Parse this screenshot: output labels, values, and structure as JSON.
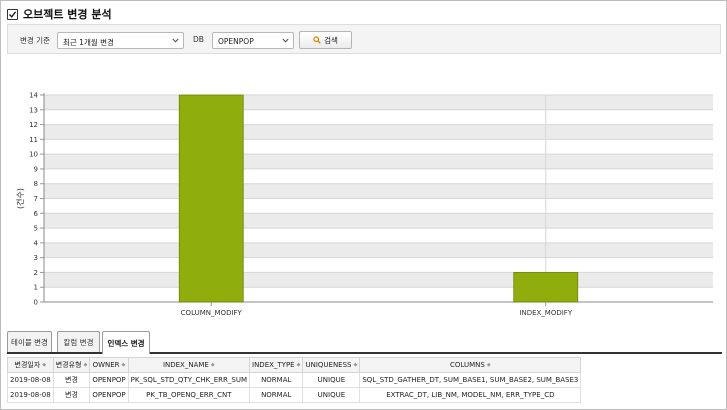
{
  "title": "오브젝트 변경 분석",
  "filters": {
    "criteria_label": "변경 기준",
    "criteria_value": "최근 1개월 변경",
    "db_label": "DB",
    "db_value": "OPENPOP",
    "search_label": "검색"
  },
  "chart_data": {
    "type": "bar",
    "categories": [
      "COLUMN_MODIFY",
      "INDEX_MODIFY"
    ],
    "values": [
      14,
      2
    ],
    "ylabel": "(건수)",
    "ylim": [
      0,
      14
    ],
    "yticks": [
      0,
      1,
      2,
      3,
      4,
      5,
      6,
      7,
      8,
      9,
      10,
      11,
      12,
      13,
      14
    ],
    "bar_color": "#8fad0c",
    "grid": true,
    "legend": "none"
  },
  "tabs": [
    {
      "label": "테이블 변경",
      "active": false
    },
    {
      "label": "칼럼 변경",
      "active": false
    },
    {
      "label": "인덱스 변경",
      "active": true
    }
  ],
  "table": {
    "headers": [
      "변경일자",
      "변경유형",
      "OWNER",
      "INDEX_NAME",
      "INDEX_TYPE",
      "UNIQUENESS",
      "COLUMNS"
    ],
    "rows": [
      [
        "2019-08-08",
        "변경",
        "OPENPOP",
        "PK_SQL_STD_QTY_CHK_ERR_SUM",
        "NORMAL",
        "UNIQUE",
        "SQL_STD_GATHER_DT, SUM_BASE1, SUM_BASE2, SUM_BASE3"
      ],
      [
        "2019-08-08",
        "변경",
        "OPENPOP",
        "PK_TB_OPENQ_ERR_CNT",
        "NORMAL",
        "UNIQUE",
        "EXTRAC_DT, LIB_NM, MODEL_NM, ERR_TYPE_CD"
      ]
    ]
  }
}
